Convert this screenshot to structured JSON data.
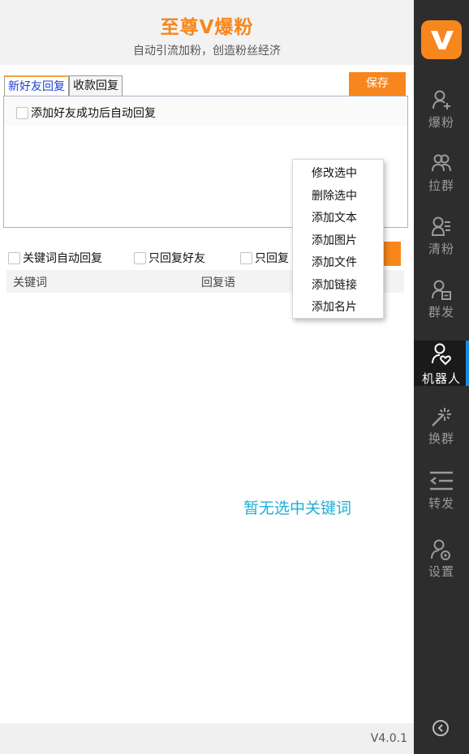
{
  "header": {
    "title": "至尊V爆粉",
    "subtitle": "自动引流加粉，创造粉丝经济"
  },
  "tabs": [
    {
      "label": "新好友回复",
      "active": true
    },
    {
      "label": "收款回复",
      "active": false
    }
  ],
  "save_label": "保存",
  "reply_panel": {
    "auto_reply_label": "添加好友成功后自动回复",
    "checked": false
  },
  "keyword": {
    "options": [
      {
        "label": "关键词自动回复",
        "checked": false
      },
      {
        "label": "只回复好友",
        "checked": false
      },
      {
        "label": "只回复",
        "checked": false
      }
    ],
    "columns": [
      "关键词",
      "回复语"
    ],
    "empty_message": "暂无选中关键词"
  },
  "context_menu": {
    "items": [
      "修改选中",
      "删除选中",
      "添加文本",
      "添加图片",
      "添加文件",
      "添加链接",
      "添加名片"
    ]
  },
  "sidebar": {
    "logo_letter": "V",
    "items": [
      {
        "label": "爆粉",
        "icon": "user-add-icon",
        "active": false
      },
      {
        "label": "拉群",
        "icon": "users-group-icon",
        "active": false
      },
      {
        "label": "清粉",
        "icon": "user-list-icon",
        "active": false
      },
      {
        "label": "群发",
        "icon": "user-message-icon",
        "active": false
      },
      {
        "label": "机器人",
        "icon": "user-heart-icon",
        "active": true
      },
      {
        "label": "换群",
        "icon": "magic-wand-icon",
        "active": false
      },
      {
        "label": "转发",
        "icon": "forward-list-icon",
        "active": false
      },
      {
        "label": "设置",
        "icon": "user-settings-icon",
        "active": false
      }
    ]
  },
  "version": "V4.0.1",
  "colors": {
    "accent": "#f7861d",
    "sidebar_bg": "#2d2d2d",
    "active_bar": "#1e88e5",
    "empty_text": "#1cb0d8",
    "tab_active_text": "#1a3fd9"
  }
}
